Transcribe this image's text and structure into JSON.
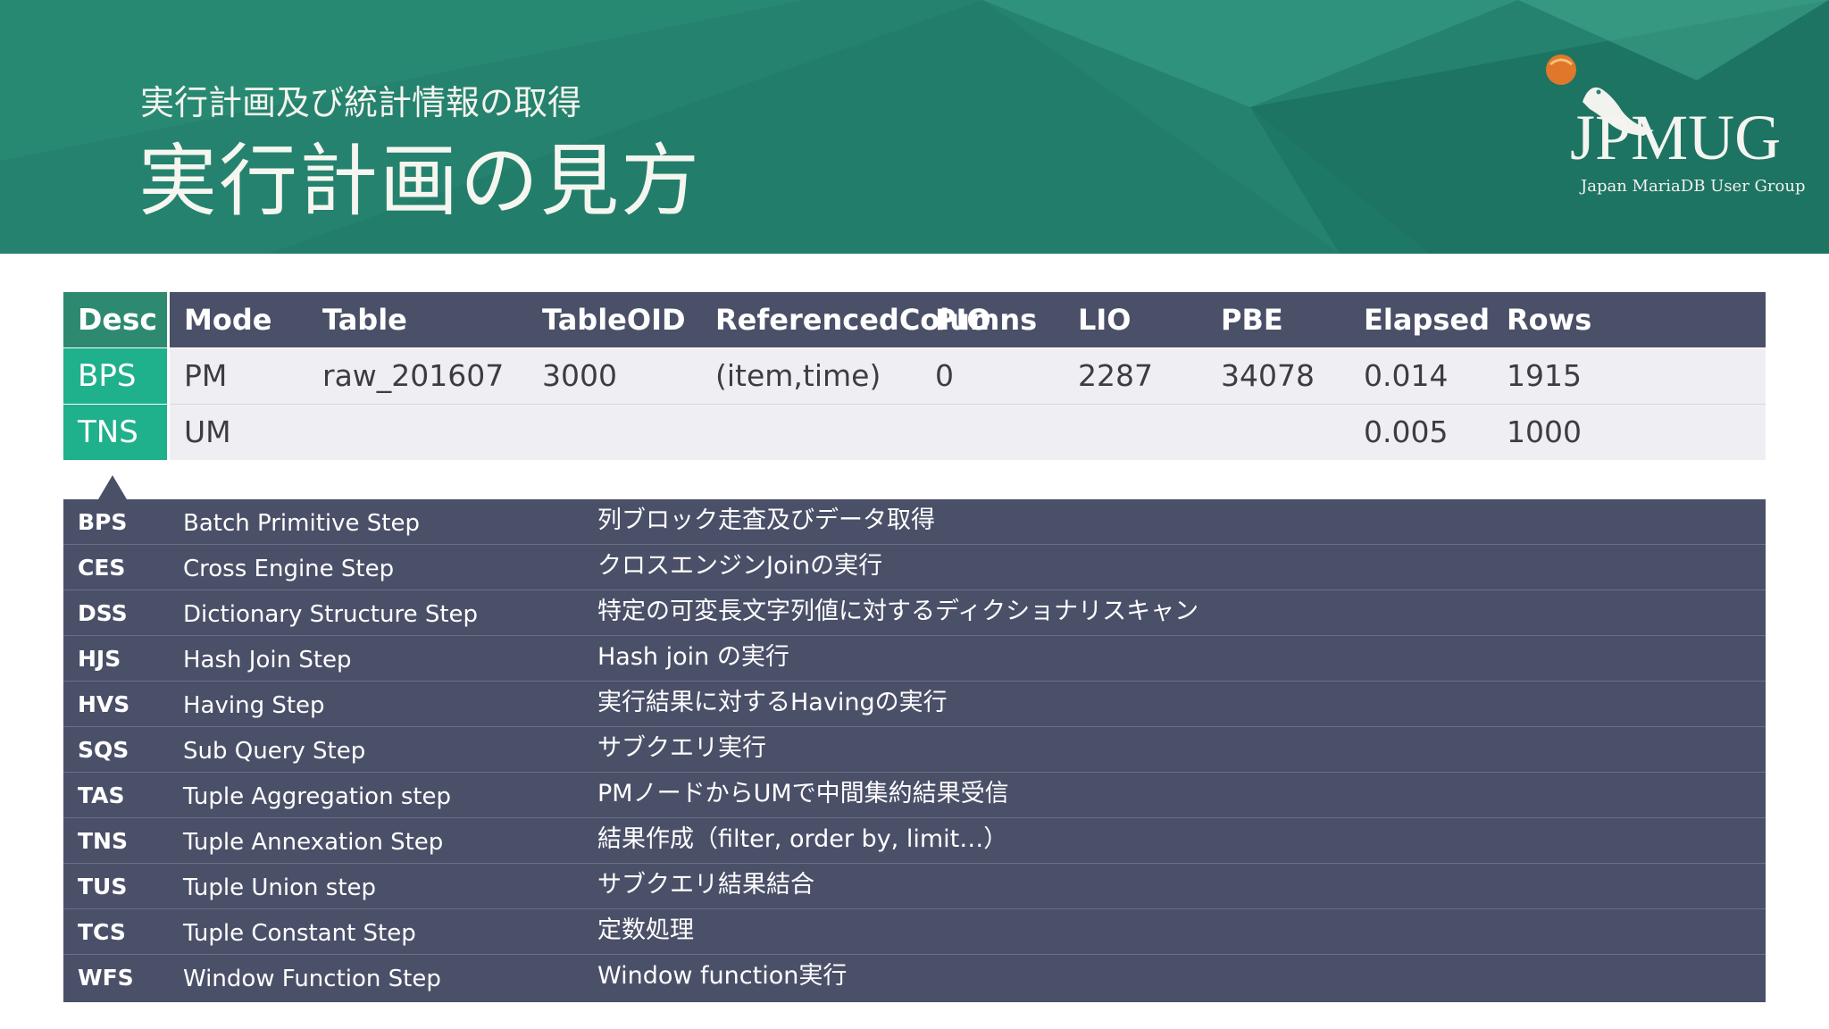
{
  "slide": {
    "subtitle": "実行計画及び統計情報の取得",
    "title": "実行計画の見方",
    "logo": {
      "word": "JPMUG",
      "tagline": "Japan MariaDB User Group"
    }
  },
  "plan_table": {
    "headers": [
      "Desc",
      "Mode",
      "Table",
      "TableOID",
      "ReferencedColumns",
      "PIO",
      "LIO",
      "PBE",
      "Elapsed",
      "Rows"
    ],
    "rows": [
      [
        "BPS",
        "PM",
        "raw_201607",
        "3000",
        "(item,time)",
        "0",
        "2287",
        "34078",
        "0.014",
        "1915"
      ],
      [
        "TNS",
        "UM",
        "",
        "",
        "",
        "",
        "",
        "",
        "0.005",
        "1000"
      ]
    ]
  },
  "steps": [
    {
      "abbr": "BPS",
      "name": "Batch Primitive Step",
      "desc": "列ブロック走査及びデータ取得"
    },
    {
      "abbr": "CES",
      "name": "Cross Engine Step",
      "desc": "クロスエンジンJoinの実行"
    },
    {
      "abbr": "DSS",
      "name": "Dictionary Structure Step",
      "desc": "特定の可変長文字列値に対するディクショナリスキャン"
    },
    {
      "abbr": "HJS",
      "name": "Hash Join Step",
      "desc": "Hash join の実行"
    },
    {
      "abbr": "HVS",
      "name": "Having Step",
      "desc": "実行結果に対するHavingの実行"
    },
    {
      "abbr": "SQS",
      "name": "Sub Query Step",
      "desc": "サブクエリ実行"
    },
    {
      "abbr": "TAS",
      "name": "Tuple Aggregation step",
      "desc": "PMノードからUMで中間集約結果受信"
    },
    {
      "abbr": "TNS",
      "name": "Tuple Annexation Step",
      "desc": "結果作成（filter, order by, limit…）"
    },
    {
      "abbr": "TUS",
      "name": "Tuple Union step",
      "desc": "サブクエリ結果結合"
    },
    {
      "abbr": "TCS",
      "name": "Tuple Constant Step",
      "desc": "定数処理"
    },
    {
      "abbr": "WFS",
      "name": "Window Function Step",
      "desc": "Window function実行"
    }
  ],
  "colors": {
    "banner": "#25826e",
    "desc_column": "#1fb08c",
    "header_dark": "#4b5069",
    "row_light": "#efeff3"
  }
}
